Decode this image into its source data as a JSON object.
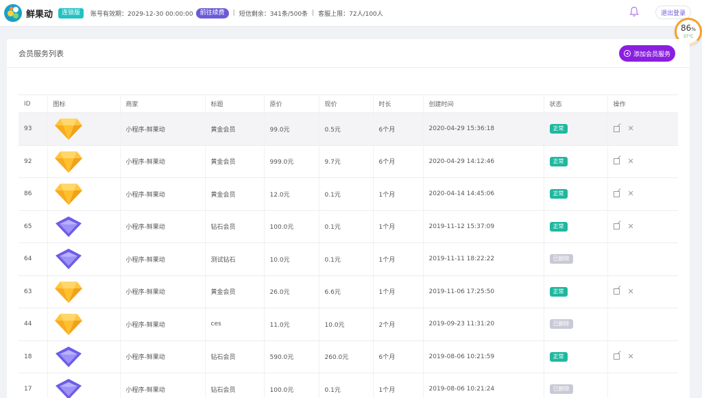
{
  "header": {
    "app_name": "鲜果动",
    "edition": "连锁版",
    "expiry": "账号有效期：2029-12-30 00:00:00",
    "renew_label": "前往续费",
    "sms": "短信剩余：341条/500条",
    "cs_limit": "客服上限：72人/100人",
    "separator": "|",
    "logout_label": "退出登录",
    "icons": [
      "logo",
      "bell-icon"
    ],
    "accent": "#6b5bd6"
  },
  "gauge": {
    "percent": "86",
    "unit": "%",
    "temperature": "37°C"
  },
  "card": {
    "title": "会员服务列表",
    "add_button": "添加会员服务",
    "add_button_color": "#8a1fe0"
  },
  "table": {
    "columns": [
      "ID",
      "图标",
      "商家",
      "标题",
      "原价",
      "现价",
      "时长",
      "创建时间",
      "状态",
      "操作"
    ],
    "rows": [
      {
        "id": "93",
        "icon": "gold-gem",
        "merchant": "小程序-鲜果动",
        "title": "黄金会员",
        "orig": "99.0元",
        "now": "0.5元",
        "duration": "6个月",
        "created": "2020-04-29 15:36:18",
        "status": "正常",
        "status_type": "ok"
      },
      {
        "id": "92",
        "icon": "gold-gem",
        "merchant": "小程序-鲜果动",
        "title": "黄金会员",
        "orig": "999.0元",
        "now": "9.7元",
        "duration": "6个月",
        "created": "2020-04-29 14:12:46",
        "status": "正常",
        "status_type": "ok"
      },
      {
        "id": "86",
        "icon": "gold-gem",
        "merchant": "小程序-鲜果动",
        "title": "黄金会员",
        "orig": "12.0元",
        "now": "0.1元",
        "duration": "1个月",
        "created": "2020-04-14 14:45:06",
        "status": "正常",
        "status_type": "ok"
      },
      {
        "id": "65",
        "icon": "purple-gem",
        "merchant": "小程序-鲜果动",
        "title": "钻石会员",
        "orig": "100.0元",
        "now": "0.1元",
        "duration": "1个月",
        "created": "2019-11-12 15:37:09",
        "status": "正常",
        "status_type": "ok"
      },
      {
        "id": "64",
        "icon": "purple-gem",
        "merchant": "小程序-鲜果动",
        "title": "测试钻石",
        "orig": "10.0元",
        "now": "0.1元",
        "duration": "1个月",
        "created": "2019-11-11 18:22:22",
        "status": "已删除",
        "status_type": "del"
      },
      {
        "id": "63",
        "icon": "gold-gem",
        "merchant": "小程序-鲜果动",
        "title": "黄金会员",
        "orig": "26.0元",
        "now": "6.6元",
        "duration": "1个月",
        "created": "2019-11-06 17:25:50",
        "status": "正常",
        "status_type": "ok"
      },
      {
        "id": "44",
        "icon": "gold-gem",
        "merchant": "小程序-鲜果动",
        "title": "ces",
        "orig": "11.0元",
        "now": "10.0元",
        "duration": "2个月",
        "created": "2019-09-23 11:31:20",
        "status": "已删除",
        "status_type": "del"
      },
      {
        "id": "18",
        "icon": "purple-gem",
        "merchant": "小程序-鲜果动",
        "title": "钻石会员",
        "orig": "590.0元",
        "now": "260.0元",
        "duration": "6个月",
        "created": "2019-08-06 10:21:59",
        "status": "正常",
        "status_type": "ok"
      },
      {
        "id": "17",
        "icon": "purple-gem",
        "merchant": "小程序-鲜果动",
        "title": "钻石会员",
        "orig": "100.0元",
        "now": "0.1元",
        "duration": "1个月",
        "created": "2019-08-06 10:21:24",
        "status": "已删除",
        "status_type": "del"
      }
    ],
    "colors": {
      "ok": "#1fb89f",
      "deleted": "#c9c9d6",
      "gold": "#ffc53d",
      "purple": "#7b6cf0"
    }
  }
}
